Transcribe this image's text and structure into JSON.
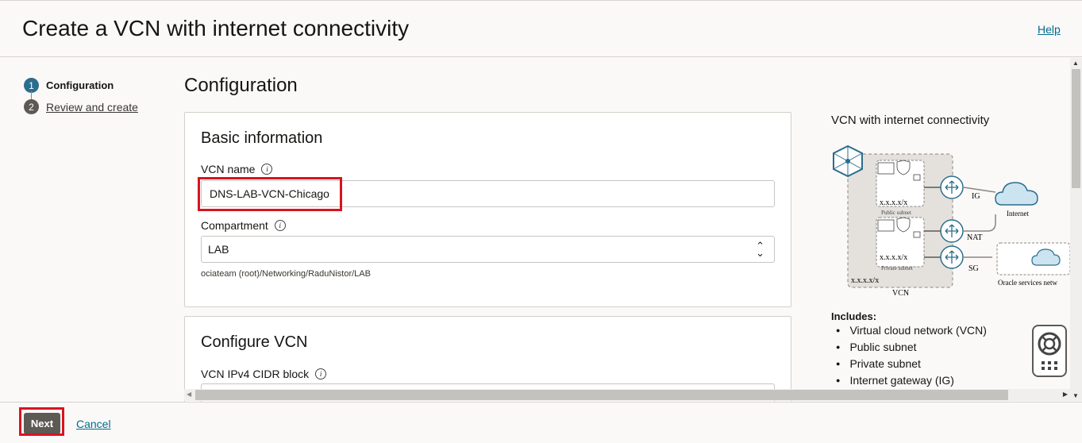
{
  "header": {
    "title": "Create a VCN with internet connectivity",
    "help_label": "Help"
  },
  "steps": [
    {
      "number": "1",
      "label": "Configuration",
      "active": true
    },
    {
      "number": "2",
      "label": "Review and create",
      "active": false
    }
  ],
  "main": {
    "title": "Configuration"
  },
  "basic_info": {
    "title": "Basic information",
    "vcn_name_label": "VCN name",
    "vcn_name_value": "DNS-LAB-VCN-Chicago",
    "compartment_label": "Compartment",
    "compartment_value": "LAB",
    "compartment_path": "ociateam (root)/Networking/RaduNistor/LAB"
  },
  "configure_vcn": {
    "title": "Configure VCN",
    "cidr_label": "VCN IPv4 CIDR block"
  },
  "side_panel": {
    "title": "VCN with internet connectivity",
    "diagram": {
      "public_subnet_cidr": "x.x.x.x/x",
      "public_subnet_label": "Public subnet",
      "private_subnet_cidr": "x.x.x.x/x",
      "private_subnet_label": "Private subnet",
      "vcn_cidr": "x.x.x.x/x",
      "vcn_label": "VCN",
      "ig_label": "IG",
      "nat_label": "NAT",
      "sg_label": "SG",
      "internet_label": "Internet",
      "oracle_services_label": "Oracle services netw"
    },
    "includes_label": "Includes:",
    "includes": [
      "Virtual cloud network (VCN)",
      "Public subnet",
      "Private subnet",
      "Internet gateway (IG)"
    ]
  },
  "footer": {
    "next_label": "Next",
    "cancel_label": "Cancel"
  },
  "colors": {
    "accent": "#2b6d8c",
    "link": "#006b8f",
    "highlight": "#d7141f",
    "button": "#5d5955"
  }
}
